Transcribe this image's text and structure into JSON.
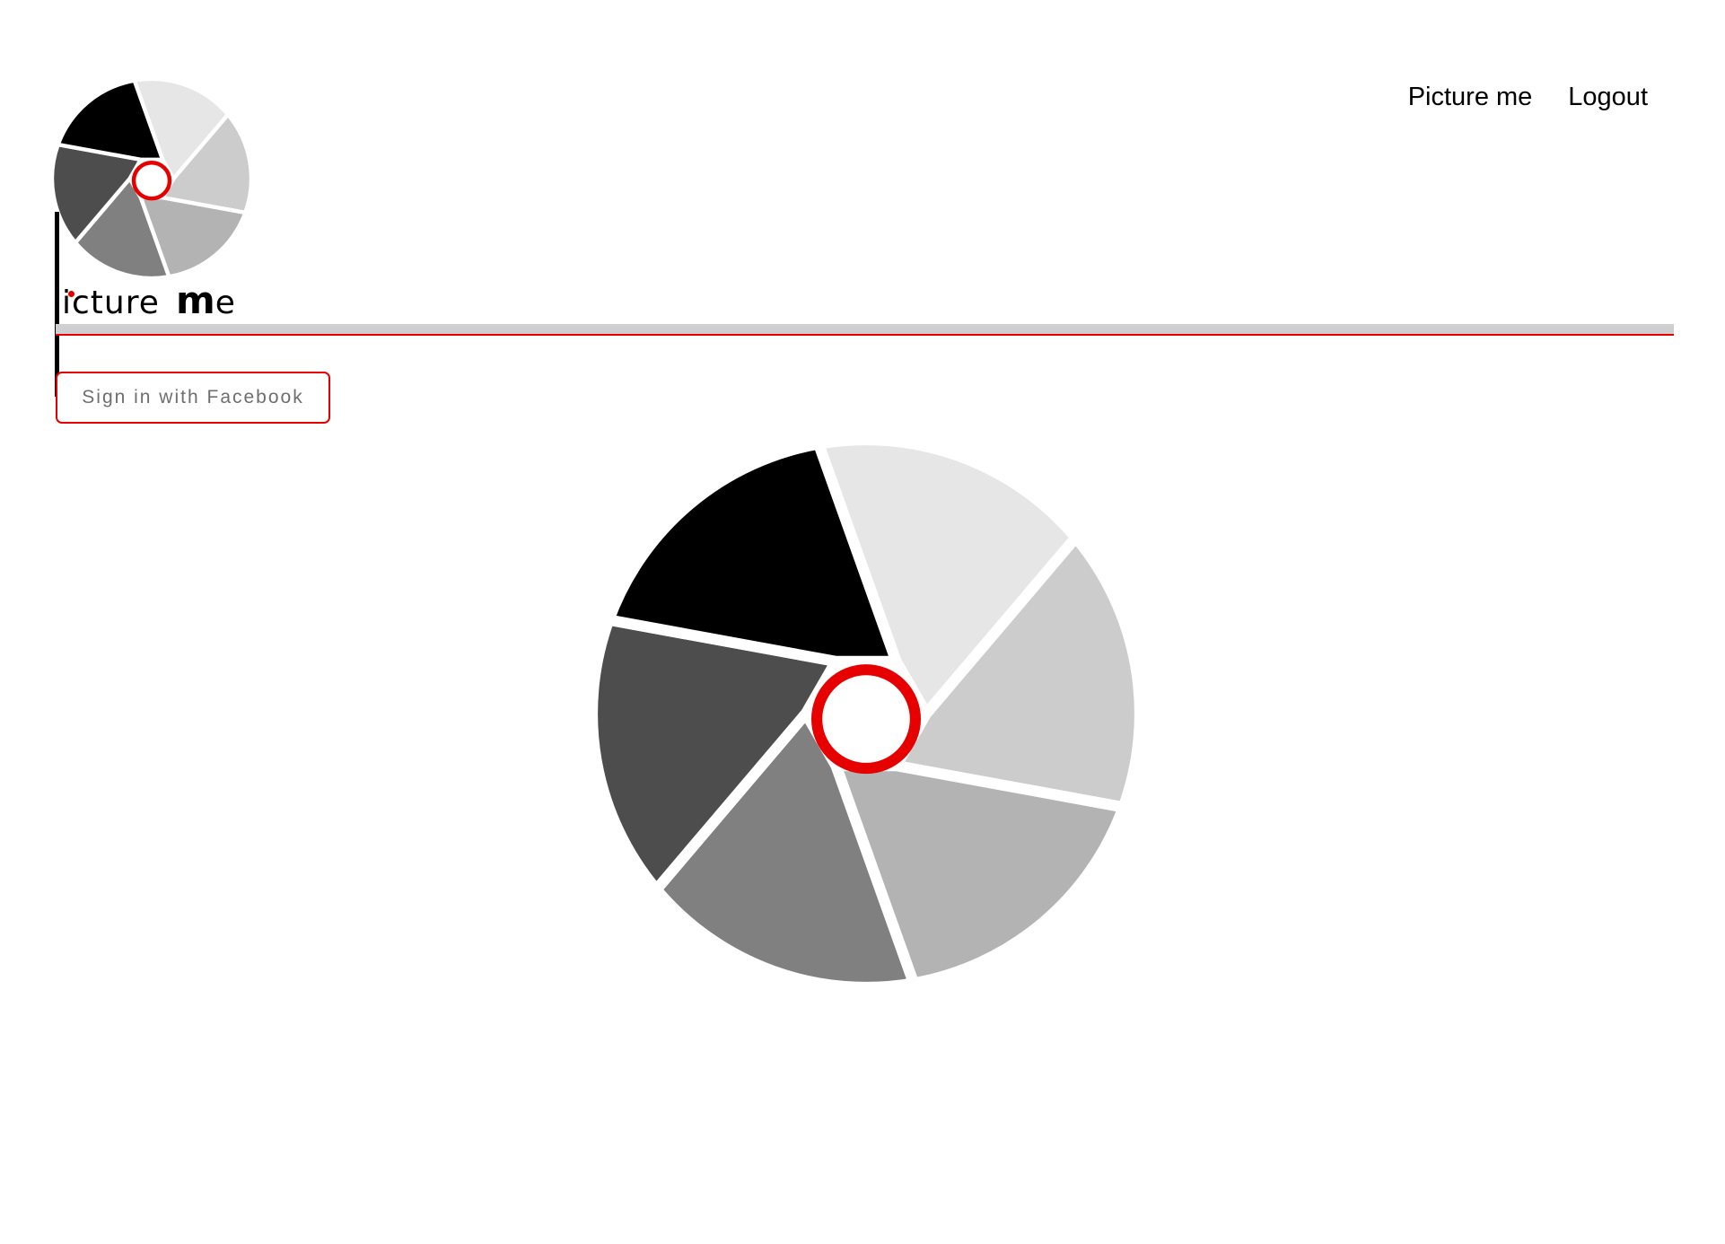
{
  "app": {
    "logo_text_part1": "icture",
    "logo_text_part2_m": "m",
    "logo_text_part2_e": "e"
  },
  "nav": {
    "items": [
      {
        "label": "Picture me"
      },
      {
        "label": "Logout"
      }
    ]
  },
  "auth": {
    "facebook_button_label": "Sign in with Facebook"
  },
  "icons": {
    "logo": "camera-aperture-logo-icon",
    "hero": "camera-aperture-icon"
  },
  "colors": {
    "accent": "#e60000",
    "divider": "#cfcfd1",
    "button_text": "#6e6e6e",
    "blade_shades": [
      "#e6e6e6",
      "#cccccc",
      "#b3b3b3",
      "#808080",
      "#4d4d4d",
      "#000000"
    ]
  }
}
